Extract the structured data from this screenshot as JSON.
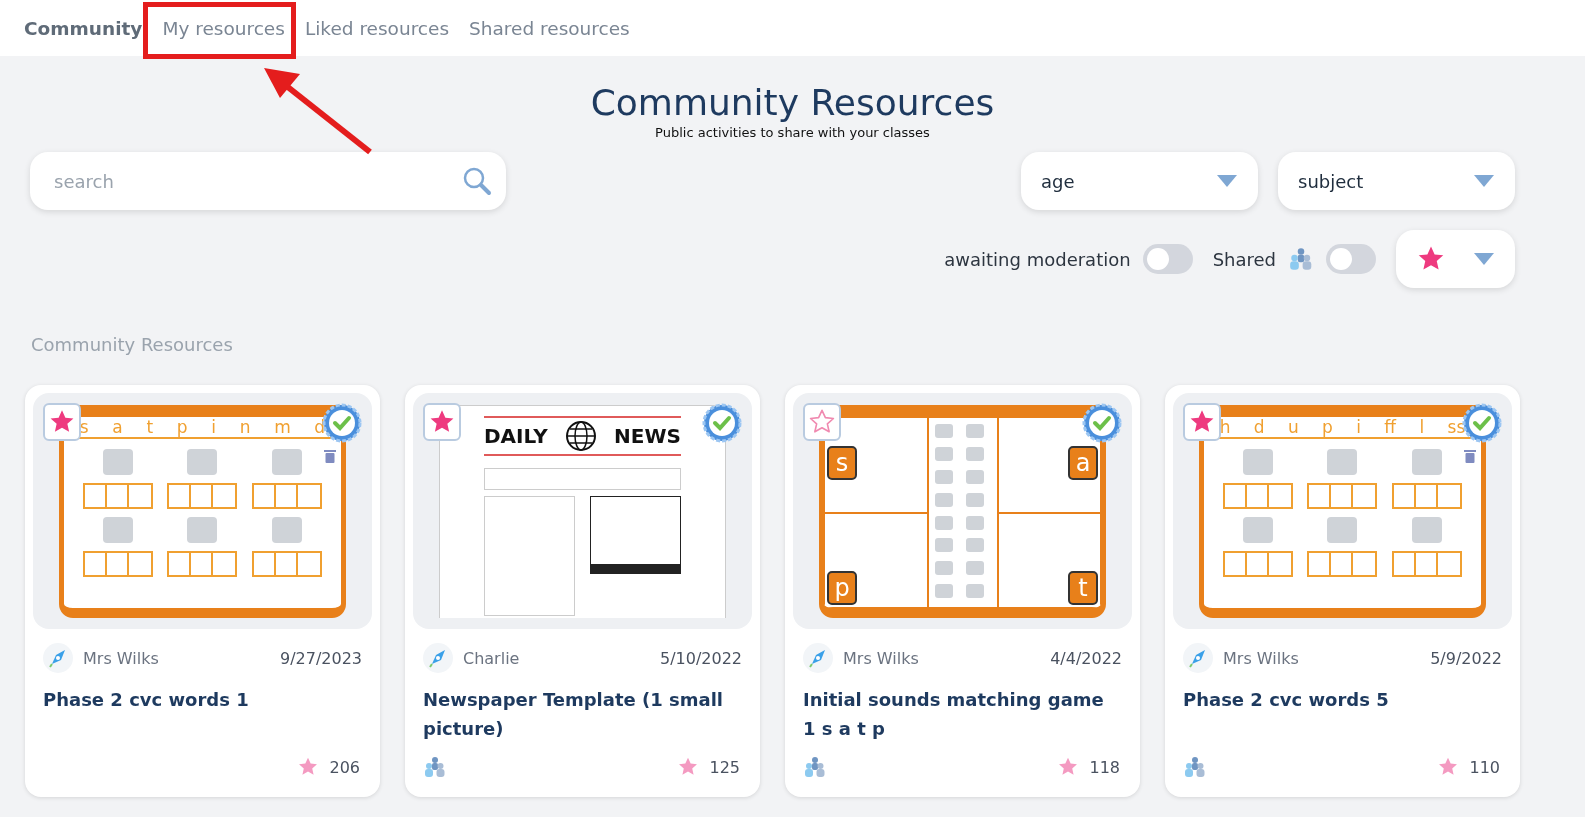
{
  "tabs": [
    {
      "label": "Community",
      "selected": true
    },
    {
      "label": "My resources",
      "selected": false,
      "highlighted": true
    },
    {
      "label": "Liked resources",
      "selected": false
    },
    {
      "label": "Shared resources",
      "selected": false
    }
  ],
  "header": {
    "title": "Community Resources",
    "subtitle": "Public activities to share with your classes"
  },
  "search": {
    "placeholder": "search"
  },
  "dropdowns": [
    {
      "label": "age"
    },
    {
      "label": "subject"
    }
  ],
  "toggles": [
    {
      "label": "awaiting moderation",
      "on": false,
      "icon": false
    },
    {
      "label": "Shared",
      "on": false,
      "icon": true
    }
  ],
  "section_label": "Community Resources",
  "cards": [
    {
      "kind": "letters",
      "letters": [
        "s",
        "a",
        "t",
        "p",
        "i",
        "n",
        "m",
        "d"
      ],
      "favorite": true,
      "verified": true,
      "trash": true,
      "author": "Mrs Wilks",
      "date": "9/27/2023",
      "title": "Phase 2 cvc words 1",
      "shared": false,
      "likes": "206"
    },
    {
      "kind": "newspaper",
      "masthead": [
        "DAILY",
        "NEWS"
      ],
      "favorite": true,
      "verified": true,
      "trash": false,
      "author": "Charlie",
      "date": "5/10/2022",
      "title": "Newspaper Template (1 small picture)",
      "shared": true,
      "likes": "125"
    },
    {
      "kind": "corners",
      "letters": [
        "s",
        "a",
        "p",
        "t"
      ],
      "favorite": false,
      "verified": true,
      "trash": false,
      "author": "Mrs Wilks",
      "date": "4/4/2022",
      "title": "Initial sounds matching game 1 s a t p",
      "shared": true,
      "likes": "118"
    },
    {
      "kind": "letters",
      "letters": [
        "h",
        "d",
        "u",
        "p",
        "i",
        "ff",
        "l",
        "ss"
      ],
      "favorite": true,
      "verified": true,
      "trash": true,
      "author": "Mrs Wilks",
      "date": "5/9/2022",
      "title": "Phase 2 cvc words 5",
      "shared": true,
      "likes": "110"
    }
  ]
}
